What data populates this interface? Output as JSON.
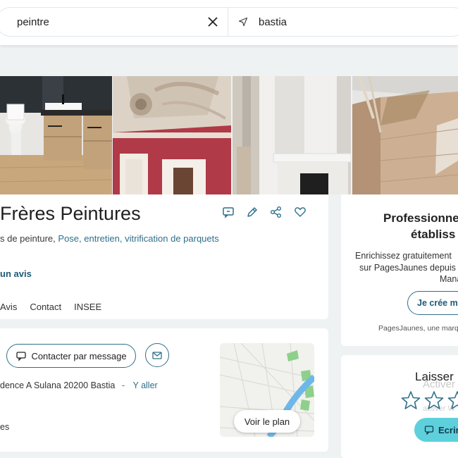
{
  "search": {
    "what_value": "peintre",
    "where_value": "bastia"
  },
  "listing": {
    "title": "Frères Peintures",
    "categories_prefix": "s de peinture,",
    "categories_link": "Pose, entretien, vitrification de parquets",
    "review_link": "un avis",
    "tabs": [
      "Avis",
      "Contact",
      "INSEE"
    ]
  },
  "contact": {
    "message_button": "Contacter par message",
    "address": "dence A Sulana 20200 Bastia",
    "address_separator": "-",
    "directions_link": "Y aller",
    "more_text": "es",
    "map_button": "Voir le plan"
  },
  "pro_box": {
    "title_line1": "Professionne",
    "title_line2": "établiss",
    "text_line1": "Enrichissez gratuitement",
    "text_line2": "sur PagesJaunes depuis",
    "text_line3": "Mana",
    "create_button": "Je crée mo",
    "footer": "PagesJaunes, une marqu"
  },
  "review_box": {
    "title": "Laisser",
    "ghost_line1": "Activer",
    "ghost_line2": "activer W",
    "write_button": "Ecrir"
  },
  "colors": {
    "accent": "#2f6f8a",
    "button_fill": "#5ed0dc",
    "background": "#eef2f3"
  }
}
